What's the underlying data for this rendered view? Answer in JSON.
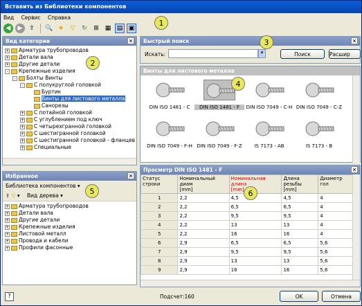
{
  "window": {
    "title": "Вставить из Библиотеки компонентов"
  },
  "menu": [
    "Вид",
    "Сервис",
    "Справка"
  ],
  "badges": [
    "1",
    "2",
    "3",
    "4",
    "5",
    "6"
  ],
  "category_view": {
    "title": "Вид категории",
    "items": [
      {
        "label": "Арматура трубопроводов",
        "level": 0,
        "expand": "+"
      },
      {
        "label": "Детали вала",
        "level": 0,
        "expand": "+"
      },
      {
        "label": "Другие детали",
        "level": 0,
        "expand": "+"
      },
      {
        "label": "Крепежные изделия",
        "level": 0,
        "expand": "-"
      },
      {
        "label": "Болты Винты",
        "level": 1,
        "expand": "-"
      },
      {
        "label": "С полукруглой головкой",
        "level": 2,
        "expand": "-"
      },
      {
        "label": "Буртик",
        "level": 3,
        "expand": ""
      },
      {
        "label": "Винты для листового металла",
        "level": 3,
        "expand": "",
        "selected": true
      },
      {
        "label": "Санорезы",
        "level": 3,
        "expand": ""
      },
      {
        "label": "С потайной головкой",
        "level": 2,
        "expand": "+"
      },
      {
        "label": "С углублением под ключ",
        "level": 2,
        "expand": "+"
      },
      {
        "label": "С четырехгранной головкой",
        "level": 2,
        "expand": "+"
      },
      {
        "label": "С шестигранной головкой",
        "level": 2,
        "expand": "+"
      },
      {
        "label": "С шестигранной головкой - фланцев",
        "level": 2,
        "expand": "+"
      },
      {
        "label": "Специальные",
        "level": 2,
        "expand": "+"
      }
    ]
  },
  "favorites": {
    "title": "Избранное",
    "library_label": "Библиотека компонентов",
    "view_label": "Вид дерева",
    "items": [
      "Арматура трубопроводов",
      "Детали вала",
      "Другие детали",
      "Крепежные изделия",
      "Листовой металл",
      "Провода и кабели",
      "Профили фасонные"
    ]
  },
  "quick_search": {
    "title": "Быстрый поиск",
    "search_label": "Искать:",
    "search_value": "",
    "search_button": "Поиск",
    "advanced_button": "Расшир"
  },
  "sheet_metal": {
    "title": "Винты для листового металла",
    "items": [
      "DIN ISO 1481 - C",
      "DIN ISO 1481 - F",
      "DIN ISO 7049 - C-H",
      "DIN ISO 7049 - C-Z",
      "DIN ISO 7049 - F-H",
      "DIN ISO 7049 - F-Z",
      "IS 7173 - AB",
      "IS 7173 - B"
    ],
    "selected_index": 1
  },
  "preview": {
    "title": "Просмотр DIN ISO 1481 - F",
    "columns": [
      "Статус строки",
      "Номинальный диам\n[mm]",
      "Номинальная длина\n[mm]",
      "Длина резьбы\n[mm]",
      "Диаметр гол"
    ],
    "rows": [
      [
        "1",
        "2,2",
        "4,5",
        "4,5",
        "4"
      ],
      [
        "2",
        "2,2",
        "6,5",
        "6,5",
        "4"
      ],
      [
        "3",
        "2,2",
        "9,5",
        "9,5",
        "4"
      ],
      [
        "4",
        "2,2",
        "13",
        "13",
        "4"
      ],
      [
        "5",
        "2,2",
        "16",
        "16",
        "4"
      ],
      [
        "6",
        "2,9",
        "6,5",
        "6,5",
        "5,6"
      ],
      [
        "7",
        "2,9",
        "9,5",
        "9,5",
        "5,6"
      ],
      [
        "8",
        "2,9",
        "13",
        "13",
        "5,6"
      ],
      [
        "9",
        "2,9",
        "16",
        "16",
        "5,6"
      ]
    ]
  },
  "status": {
    "count_label": "Подсчет:160"
  },
  "buttons": {
    "ok": "OK",
    "cancel": "Отмена"
  }
}
